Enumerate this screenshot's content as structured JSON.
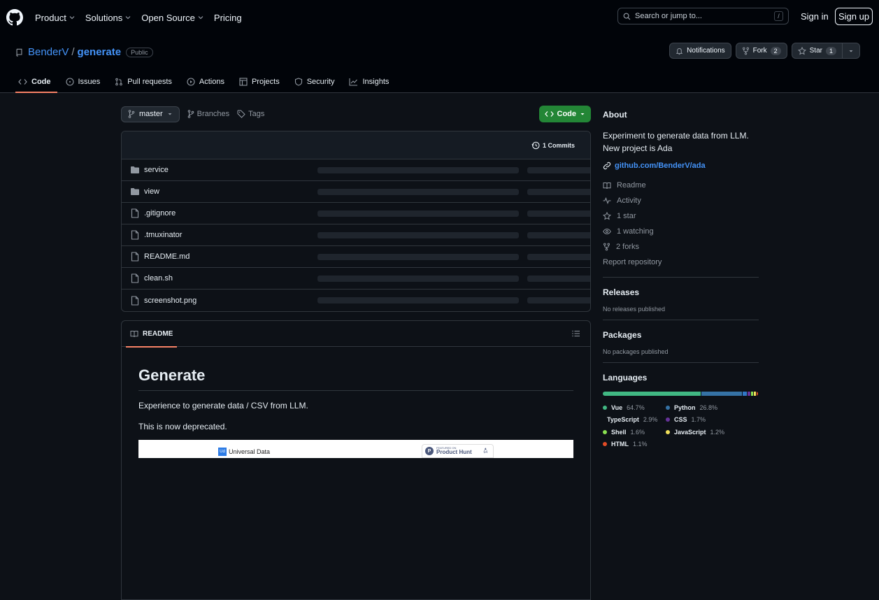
{
  "header": {
    "nav": [
      "Product",
      "Solutions",
      "Open Source",
      "Pricing"
    ],
    "search_placeholder": "Search or jump to...",
    "search_key": "/",
    "signin": "Sign in",
    "signup": "Sign up"
  },
  "repo": {
    "owner": "BenderV",
    "sep": "/",
    "name": "generate",
    "visibility": "Public",
    "notifications": "Notifications",
    "fork_label": "Fork",
    "fork_count": "2",
    "star_label": "Star",
    "star_count": "1"
  },
  "tabs": [
    "Code",
    "Issues",
    "Pull requests",
    "Actions",
    "Projects",
    "Security",
    "Insights"
  ],
  "toolbar": {
    "branch": "master",
    "branches": "Branches",
    "tags": "Tags",
    "code": "Code"
  },
  "files": {
    "commits": "1 Commits",
    "rows": [
      {
        "name": "service",
        "type": "folder"
      },
      {
        "name": "view",
        "type": "folder"
      },
      {
        "name": ".gitignore",
        "type": "file"
      },
      {
        "name": ".tmuxinator",
        "type": "file"
      },
      {
        "name": "README.md",
        "type": "file"
      },
      {
        "name": "clean.sh",
        "type": "file"
      },
      {
        "name": "screenshot.png",
        "type": "file"
      }
    ]
  },
  "readme": {
    "tab": "README",
    "title": "Generate",
    "p1": "Experience to generate data / CSV from LLM.",
    "p2": "This is now deprecated.",
    "banner_logo": "Universal Data",
    "banner_logo_mark": "Ud",
    "ph_small": "FEATURED ON",
    "ph_big": "Product Hunt",
    "ph_votes": "64"
  },
  "sidebar": {
    "about": "About",
    "description_l1": "Experiment to generate data from LLM.",
    "description_l2": "New project is Ada",
    "website": "github.com/BenderV/ada",
    "readme": "Readme",
    "activity": "Activity",
    "stars": "1 star",
    "watching": "1 watching",
    "forks": "2 forks",
    "report": "Report repository",
    "releases": "Releases",
    "releases_note": "No releases published",
    "packages": "Packages",
    "packages_note": "No packages published",
    "languages": "Languages",
    "lang_list": [
      {
        "name": "Vue",
        "pct": "64.7%",
        "value": 64.7,
        "color": "#41b883"
      },
      {
        "name": "Python",
        "pct": "26.8%",
        "value": 26.8,
        "color": "#3572A5"
      },
      {
        "name": "TypeScript",
        "pct": "2.9%",
        "value": 2.9,
        "color": "#3178c6"
      },
      {
        "name": "CSS",
        "pct": "1.7%",
        "value": 1.7,
        "color": "#663399"
      },
      {
        "name": "Shell",
        "pct": "1.6%",
        "value": 1.6,
        "color": "#89e051"
      },
      {
        "name": "JavaScript",
        "pct": "1.2%",
        "value": 1.2,
        "color": "#f1e05a"
      },
      {
        "name": "HTML",
        "pct": "1.1%",
        "value": 1.1,
        "color": "#e34c26"
      }
    ]
  }
}
